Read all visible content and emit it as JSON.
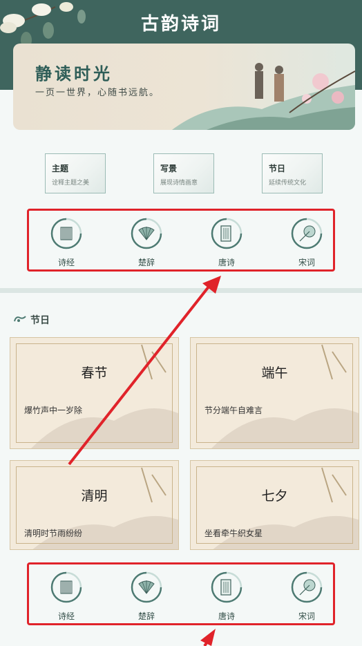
{
  "header": {
    "title": "古韵诗词"
  },
  "banner": {
    "title": "静读时光",
    "subtitle": "一页一世界，心随书远航。"
  },
  "categories": [
    {
      "title": "主题",
      "subtitle": "诠释主题之美"
    },
    {
      "title": "写景",
      "subtitle": "展现诗情画意"
    },
    {
      "title": "节日",
      "subtitle": "延续传统文化"
    }
  ],
  "nav": [
    {
      "label": "诗经",
      "icon": "bamboo-slips-icon"
    },
    {
      "label": "楚辞",
      "icon": "fan-icon"
    },
    {
      "label": "唐诗",
      "icon": "scroll-icon"
    },
    {
      "label": "宋词",
      "icon": "umbrella-icon"
    }
  ],
  "section": {
    "title": "节日"
  },
  "festivals": [
    {
      "name": "春节",
      "poem": "爆竹声中一岁除"
    },
    {
      "name": "端午",
      "poem": "节分端午自难言"
    },
    {
      "name": "清明",
      "poem": "清明时节雨纷纷"
    },
    {
      "name": "七夕",
      "poem": "坐看牵牛织女星"
    }
  ],
  "colors": {
    "header": "#3f655e",
    "accent": "#2f5e58",
    "highlight": "#e0232a"
  }
}
